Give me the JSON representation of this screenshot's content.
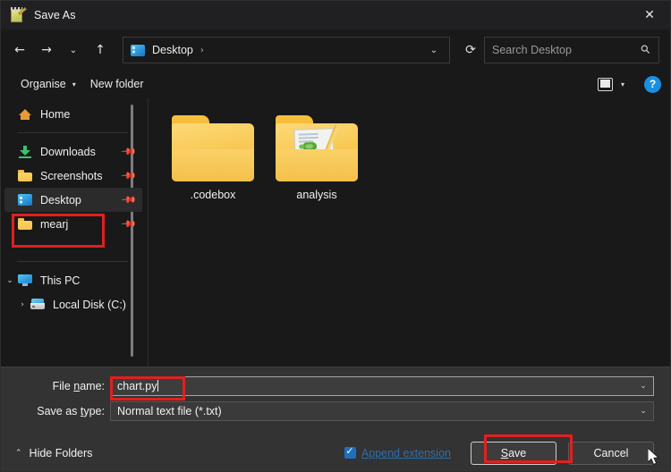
{
  "window": {
    "title": "Save As",
    "app_icon": "notepad-icon",
    "close_label": "✕"
  },
  "nav": {
    "back": "←",
    "forward": "→",
    "recent": "⌄",
    "up": "↑",
    "refresh": "⟳",
    "address": {
      "icon": "desktop-icon",
      "crumbs": [
        "Desktop"
      ],
      "separator": "›",
      "chevron": "⌄"
    },
    "search": {
      "placeholder": "Search Desktop",
      "icon": "search-icon"
    }
  },
  "toolbar": {
    "organise_label": "Organise",
    "organise_caret": "▾",
    "new_folder_label": "New folder",
    "view_caret": "▾",
    "help_label": "?"
  },
  "sidebar": {
    "items": [
      {
        "label": "Home",
        "icon": "home-icon",
        "pin": false,
        "selected": false
      },
      {
        "label": "Downloads",
        "icon": "downloads-icon",
        "pin": true,
        "selected": false
      },
      {
        "label": "Screenshots",
        "icon": "folder-icon",
        "pin": true,
        "selected": false
      },
      {
        "label": "Desktop",
        "icon": "desktop-icon",
        "pin": true,
        "selected": true
      },
      {
        "label": "mearj",
        "icon": "folder-icon",
        "pin": true,
        "selected": false
      },
      {
        "label": "This PC",
        "icon": "pc-icon",
        "chevron": "⌄",
        "pin": false,
        "selected": false
      },
      {
        "label": "Local Disk (C:)",
        "icon": "drive-icon",
        "chevron": "›",
        "pin": false,
        "selected": false
      }
    ]
  },
  "files": [
    {
      "name": ".codebox",
      "type": "folder",
      "has_preview": false
    },
    {
      "name": "analysis",
      "type": "folder",
      "has_preview": true
    }
  ],
  "form": {
    "filename_label_pre": "File ",
    "filename_label_key": "n",
    "filename_label_post": "ame:",
    "filename_value": "chart.py",
    "filetype_label_pre": "Save as ",
    "filetype_label_key": "t",
    "filetype_label_post": "ype:",
    "filetype_value": "Normal text file (*.txt)",
    "chevron": "⌄"
  },
  "actions": {
    "hide_folders_label": "Hide Folders",
    "hide_folders_chevron": "⌃",
    "append_extension_label": "Append extension",
    "append_extension_checked": true,
    "save_label_pre": "",
    "save_label_key": "S",
    "save_label_post": "ave",
    "cancel_label": "Cancel"
  },
  "colors": {
    "accent_blue": "#1a8fe0",
    "annotation_red": "#e02020",
    "folder_yellow": "#f5c24a",
    "link_blue": "#2f6ea8",
    "window_bg": "#191919",
    "bottom_bg": "#333333"
  }
}
